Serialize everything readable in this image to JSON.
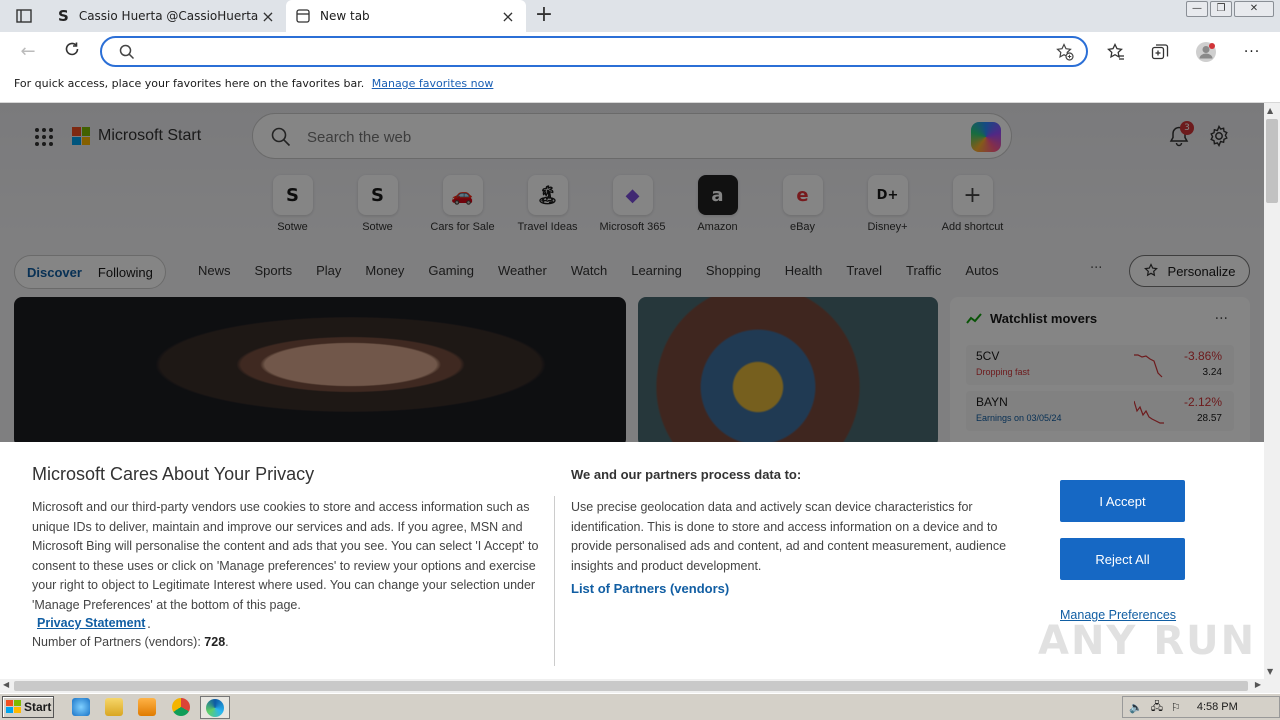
{
  "browser": {
    "tabs": [
      {
        "title": "Cassio Huerta @CassioHuerta - T",
        "active": false
      },
      {
        "title": "New tab",
        "active": true
      }
    ],
    "omnibox": {
      "value": "",
      "placeholder": ""
    },
    "favorites_bar": {
      "message": "For quick access, place your favorites here on the favorites bar.",
      "link": "Manage favorites now"
    }
  },
  "page": {
    "brand": "Microsoft Start",
    "search_placeholder": "Search the web",
    "notification_count": "3",
    "shortcuts": [
      {
        "label": "Sotwe",
        "icon": "S"
      },
      {
        "label": "Sotwe",
        "icon": "S"
      },
      {
        "label": "Cars for Sale",
        "icon": "🚗"
      },
      {
        "label": "Travel Ideas",
        "icon": "🏝"
      },
      {
        "label": "Microsoft 365",
        "icon": "◆"
      },
      {
        "label": "Amazon",
        "icon": "a"
      },
      {
        "label": "eBay",
        "icon": "e"
      },
      {
        "label": "Disney+",
        "icon": "D+"
      },
      {
        "label": "Add shortcut",
        "icon": "+"
      }
    ],
    "feed_tabs": [
      "Discover",
      "Following"
    ],
    "categories": [
      "News",
      "Sports",
      "Play",
      "Money",
      "Gaming",
      "Weather",
      "Watch",
      "Learning",
      "Shopping",
      "Health",
      "Travel",
      "Traffic",
      "Autos"
    ],
    "more": "···",
    "personalize": "Personalize",
    "watchlist": {
      "title": "Watchlist movers",
      "more": "···",
      "items": [
        {
          "symbol": "5CV",
          "note": "Dropping fast",
          "change": "-3.86%",
          "price": "3.24"
        },
        {
          "symbol": "BAYN",
          "note": "Earnings on 03/05/24",
          "change": "-2.12%",
          "price": "28.57"
        }
      ]
    }
  },
  "privacy": {
    "title": "Microsoft Cares About Your Privacy",
    "body": "Microsoft and our third-party vendors use cookies to store and access information such as unique IDs to deliver, maintain and improve our services and ads. If you agree, MSN and Microsoft Bing will personalise the content and ads that you see. You can select 'I Accept' to consent to these uses or click on 'Manage preferences' to review your options and exercise your right to object to Legitimate Interest where used.  You can change your selection under 'Manage Preferences' at the bottom of this page.",
    "privacy_link": "Privacy Statement",
    "partners_label": "Number of Partners (vendors):",
    "partners_count": "728",
    "heading2": "We and our partners process data to:",
    "body2": "Use precise geolocation data and actively scan device characteristics for identification. This is done to store and access information on a device and to provide personalised ads and content, ad and content measurement, audience insights and product development.",
    "list_link": "List of Partners (vendors)",
    "accept": "I Accept",
    "reject": "Reject All",
    "manage": "Manage Preferences"
  },
  "taskbar": {
    "start": "Start",
    "clock": "4:58 PM"
  },
  "watermark": "ANY RUN"
}
